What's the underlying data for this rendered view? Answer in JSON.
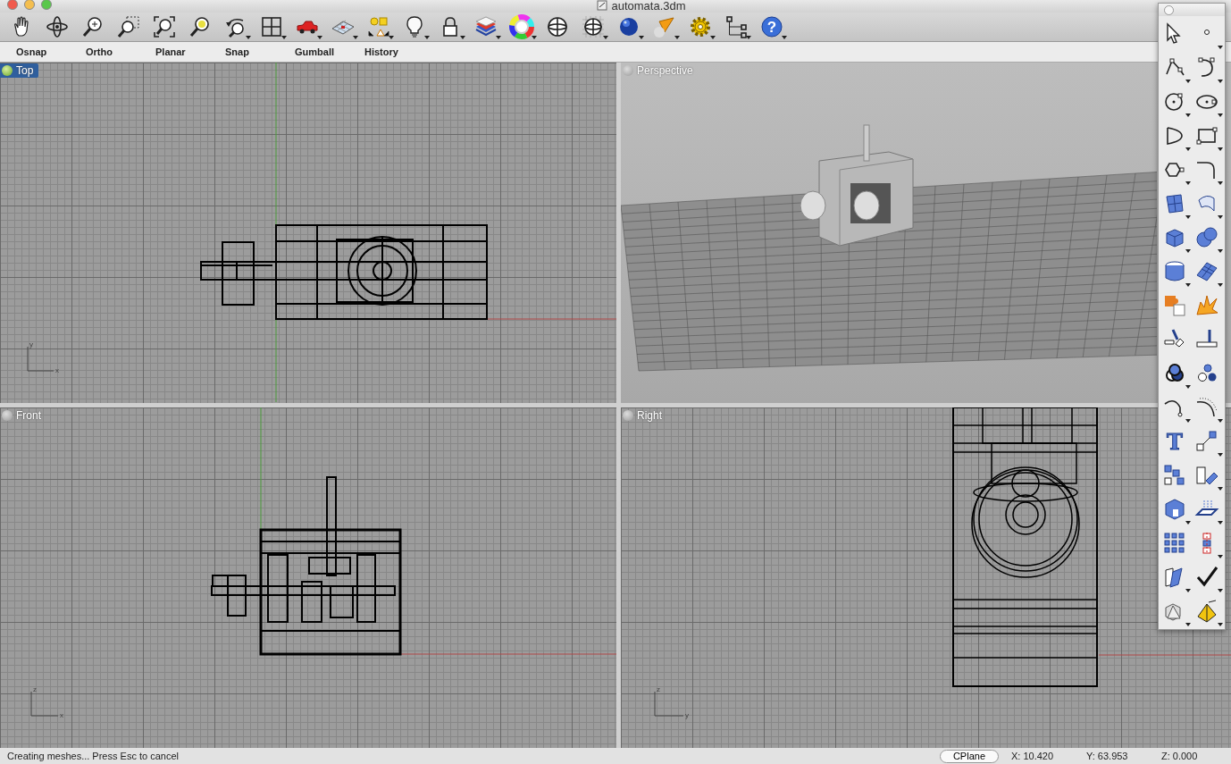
{
  "window": {
    "title": "automata.3dm"
  },
  "toolbar": {
    "help_glyph": "?"
  },
  "palette": {
    "text_tool_glyph": "T"
  },
  "command_options": [
    "Osnap",
    "Ortho",
    "Planar",
    "Snap",
    "Gumball",
    "History"
  ],
  "viewports": [
    {
      "label": "Top",
      "active": true,
      "kind": "top",
      "axes": [
        "y",
        "x"
      ]
    },
    {
      "label": "Perspective",
      "active": false,
      "kind": "perspective"
    },
    {
      "label": "Front",
      "active": false,
      "kind": "front",
      "axes": [
        "z",
        "x"
      ]
    },
    {
      "label": "Right",
      "active": false,
      "kind": "right",
      "axes": [
        "z",
        "y"
      ]
    }
  ],
  "status_bar": {
    "message": "Creating meshes... Press Esc to cancel",
    "cplane": "CPlane",
    "x": "X: 10.420",
    "y": "Y: 63.953",
    "z": "Z: 0.000"
  }
}
